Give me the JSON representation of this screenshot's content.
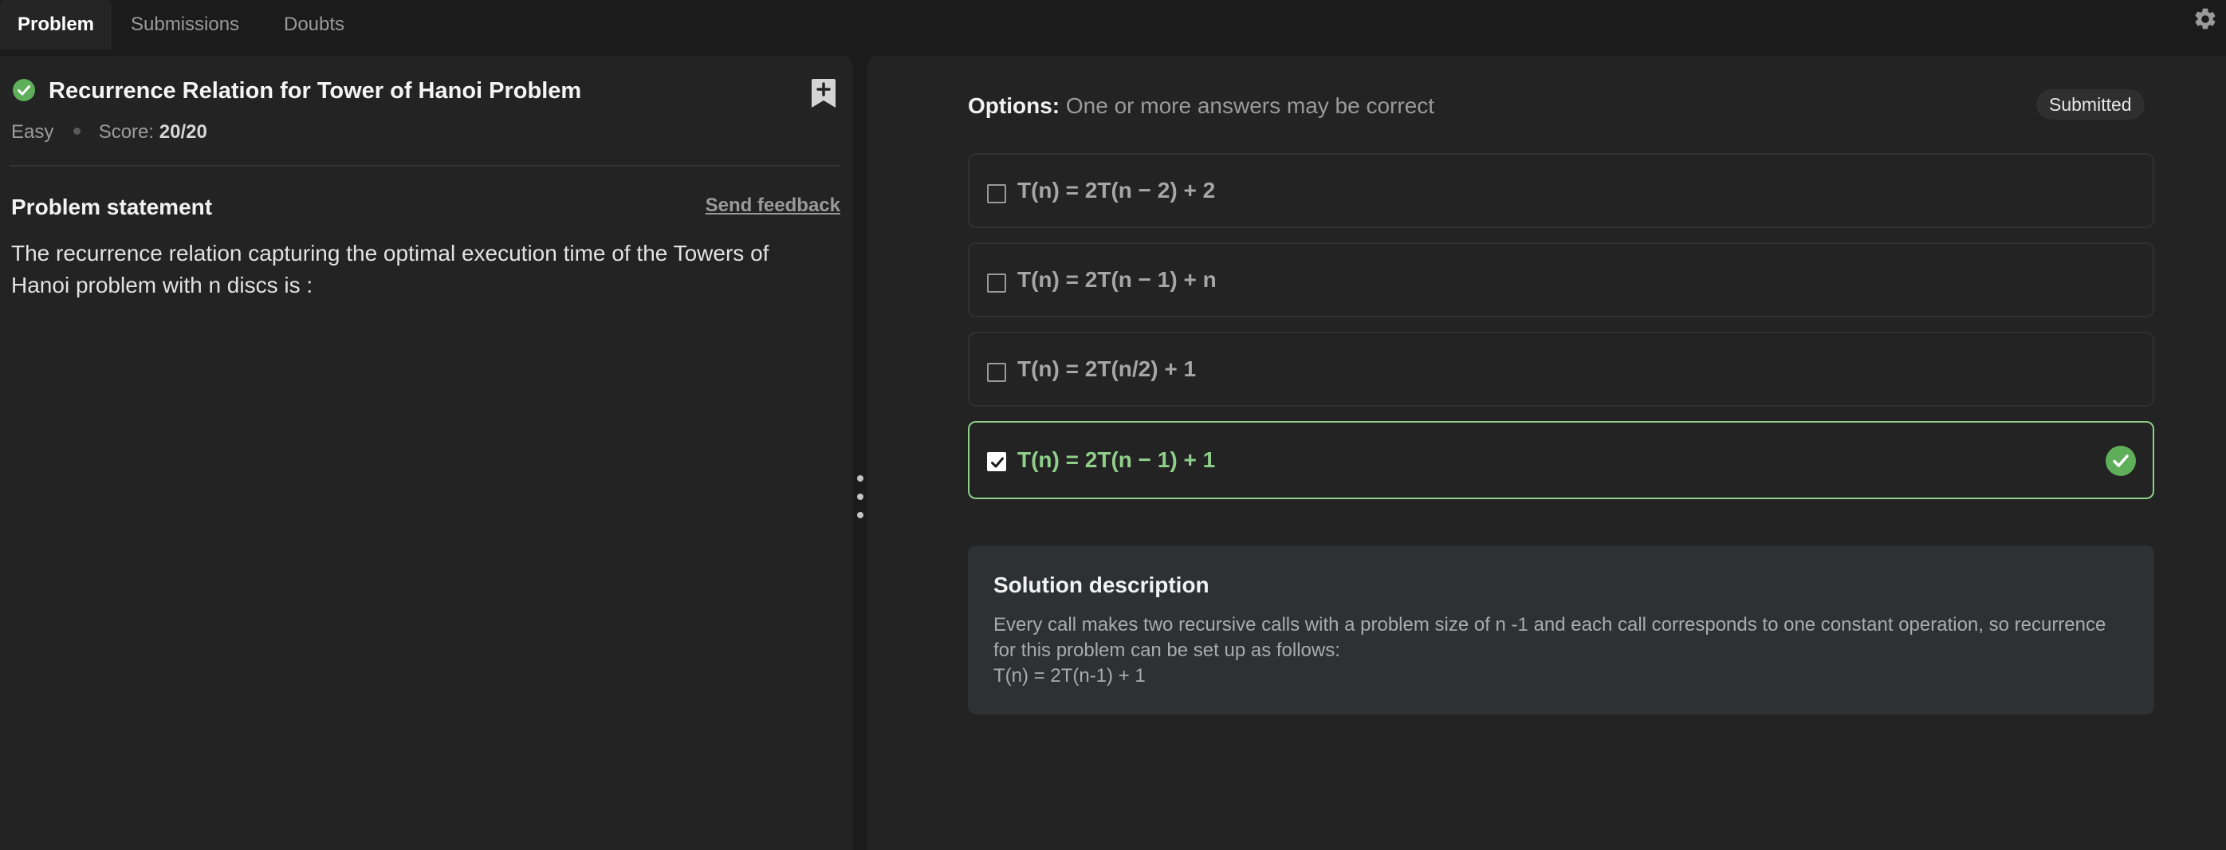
{
  "tabs": [
    {
      "label": "Problem",
      "active": true
    },
    {
      "label": "Submissions",
      "active": false
    },
    {
      "label": "Doubts",
      "active": false
    }
  ],
  "icons": {
    "settings": "gear-icon",
    "status": "check-circle-icon",
    "bookmark": "bookmark-plus-icon",
    "correct": "check-circle-icon"
  },
  "colors": {
    "accent_green": "#8fcf8a",
    "status_green": "#5fae5a",
    "panel_bg": "#232323",
    "page_bg": "#1b1b1b",
    "solution_bg": "#2d3133"
  },
  "problem": {
    "title": "Recurrence Relation for Tower of Hanoi Problem",
    "difficulty": "Easy",
    "score_label": "Score:",
    "score_value": "20/20",
    "statement_heading": "Problem statement",
    "feedback_link": "Send feedback",
    "statement": "The recurrence relation capturing the optimal execution time of the Towers of Hanoi problem with n discs is :"
  },
  "options_panel": {
    "label": "Options:",
    "hint": "One or more answers may be correct",
    "badge": "Submitted",
    "options": [
      {
        "text": "T(n) = 2T(n − 2) + 2",
        "selected": false,
        "correct": false
      },
      {
        "text": "T(n) = 2T(n − 1) + n",
        "selected": false,
        "correct": false
      },
      {
        "text": "T(n) = 2T(n/2) + 1",
        "selected": false,
        "correct": false
      },
      {
        "text": "T(n) = 2T(n − 1) + 1",
        "selected": true,
        "correct": true
      }
    ]
  },
  "solution": {
    "title": "Solution description",
    "text": "Every call makes two recursive calls with a problem size of n -1 and each call corresponds to one constant operation, so recurrence for this problem can be set up as follows:",
    "formula": "T(n) = 2T(n-1) + 1"
  }
}
